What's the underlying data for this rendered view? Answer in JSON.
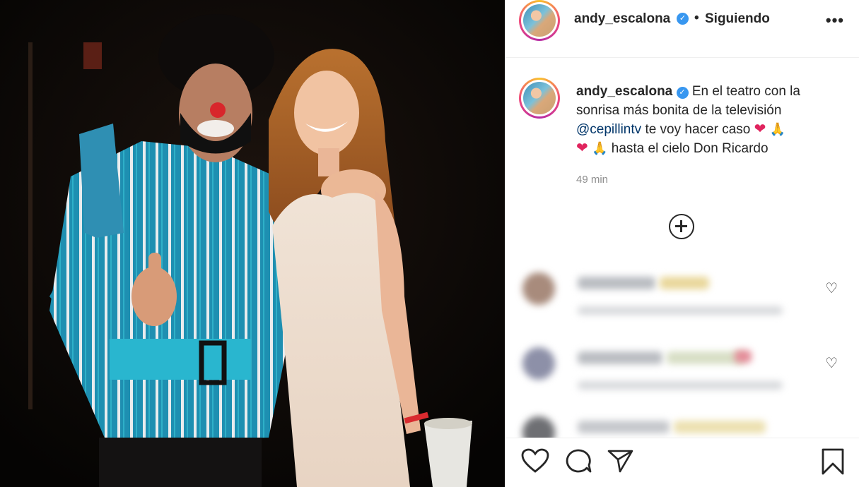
{
  "post": {
    "username": "andy_escalona",
    "verified_mark": "✓",
    "separator": "•",
    "follow_status": "Siguiendo",
    "more_label": "•••"
  },
  "caption": {
    "username": "andy_escalona",
    "line1": "En el teatro con la",
    "line2": "sonrisa más bonita de la televisión",
    "mention": "@cepillintv",
    "line3_rest": "te voy hacer caso",
    "line4_rest": "hasta el cielo Don Ricardo",
    "emoji_heart": "❤",
    "emoji_pray": "🙏",
    "time": "49 min"
  },
  "icons": {
    "load_more": "plus-circle-icon",
    "like": "heart-icon",
    "comment": "comment-icon",
    "share": "send-icon",
    "save": "bookmark-icon"
  },
  "colors": {
    "verified": "#3897f0",
    "mention": "#003569",
    "meta": "#8e8e8e"
  }
}
